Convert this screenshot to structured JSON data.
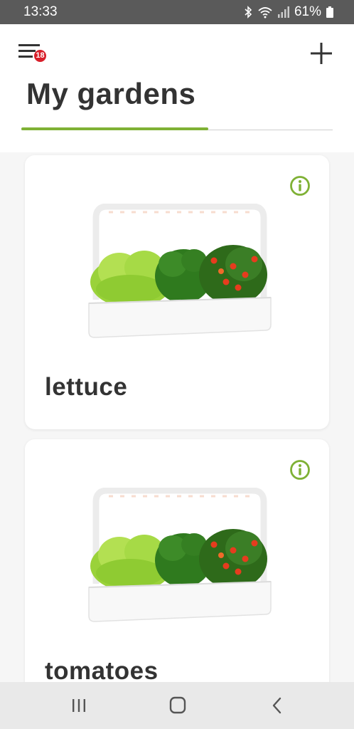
{
  "status_bar": {
    "time": "13:33",
    "battery": "61%",
    "icons": [
      "bluetooth-icon",
      "wifi-icon",
      "signal-icon",
      "battery-icon"
    ]
  },
  "header": {
    "title": "My gardens",
    "menu_badge": "18",
    "menu_icon": "menu-icon",
    "add_icon": "plus-icon"
  },
  "gardens": [
    {
      "name": "lettuce",
      "info_icon": "info-icon"
    },
    {
      "name": "tomatoes",
      "info_icon": "info-icon"
    }
  ],
  "nav_bar": {
    "icons": [
      "recent-apps-icon",
      "home-icon",
      "back-icon"
    ]
  },
  "colors": {
    "accent": "#7fb135",
    "badge": "#d81f2a",
    "status_bar": "#5a5a5a",
    "text": "#333333"
  }
}
